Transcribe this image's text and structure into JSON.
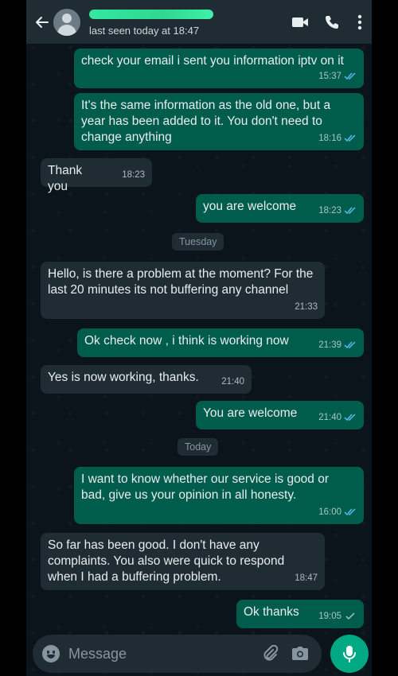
{
  "header": {
    "status": "last seen today at 18:47"
  },
  "messages": [
    {
      "text": "check your email i sent you information iptv on it",
      "time": "15:37"
    },
    {
      "text": "It's the same information as the old one, but a year has been added to it. You don't need to change anything",
      "time": "18:16"
    },
    {
      "text": "Thank you",
      "time": "18:23"
    },
    {
      "text": "you are welcome",
      "time": "18:23"
    },
    {
      "text": "Hello, is there a problem at the moment? For the last 20 minutes its not buffering any channel",
      "time": "21:33"
    },
    {
      "text": "Ok check now , i think is working now",
      "time": "21:39"
    },
    {
      "text": "Yes is now working, thanks.",
      "time": "21:40"
    },
    {
      "text": "You are welcome",
      "time": "21:40"
    },
    {
      "text": "I want to know whether our service is good or bad, give us your opinion in all honesty.",
      "time": "16:00"
    },
    {
      "text": "So far has been good. I don't have any complaints. You also were quick to respond when I had a buffering problem.",
      "time": "18:47"
    },
    {
      "text": "Ok thanks",
      "time": "19:05"
    }
  ],
  "dates": [
    "Tuesday",
    "Today"
  ],
  "input": {
    "placeholder": "Message"
  },
  "colors": {
    "background": "#0b141a",
    "outgoing_bubble": "#005c4b",
    "incoming_bubble": "#1f2c34",
    "read_ticks": "#53bdeb",
    "send_button": "#00a884"
  },
  "icons": [
    "back-arrow-icon",
    "avatar-icon",
    "video-call-icon",
    "phone-icon",
    "more-options-icon",
    "emoji-icon",
    "attach-icon",
    "camera-icon",
    "mic-icon"
  ]
}
